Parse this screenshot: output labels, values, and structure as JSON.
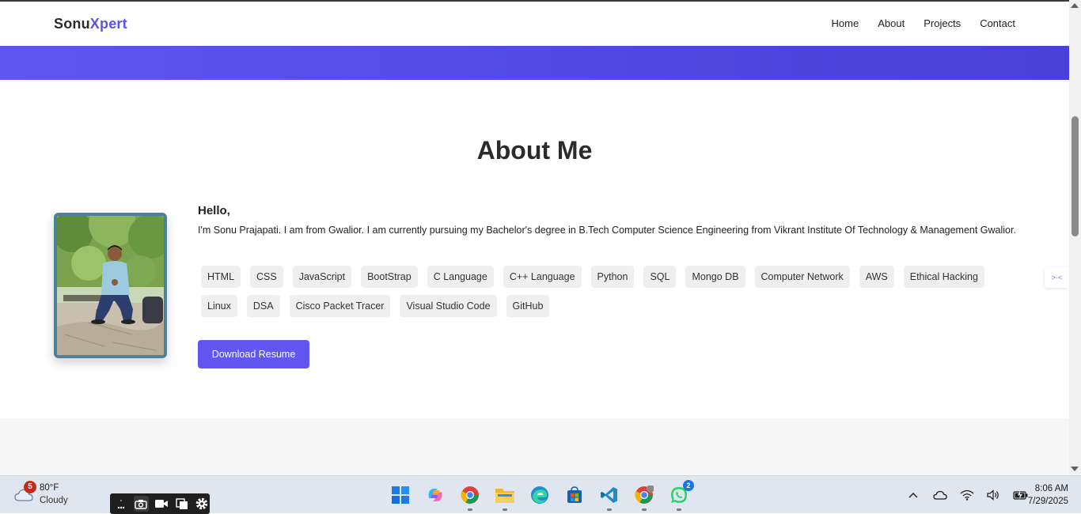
{
  "nav": {
    "brand_part1": "Sonu",
    "brand_part2": "Xpert",
    "links": [
      "Home",
      "About",
      "Projects",
      "Contact"
    ]
  },
  "about": {
    "title": "About Me",
    "greeting": "Hello,",
    "intro": "I'm Sonu Prajapati. I am from Gwalior. I am currently pursuing my Bachelor's degree in B.Tech Computer Science Engineering from Vikrant Institute Of Technology & Management Gwalior.",
    "skills": [
      "HTML",
      "CSS",
      "JavaScript",
      "BootStrap",
      "C Language",
      "C++ Language",
      "Python",
      "SQL",
      "Mongo DB",
      "Computer Network",
      "AWS",
      "Ethical Hacking",
      "Linux",
      "DSA",
      "Cisco Packet Tracer",
      "Visual Studio Code",
      "GitHub"
    ],
    "download_label": "Download Resume"
  },
  "colors": {
    "accent": "#5b53e8",
    "hero_band": "#5147e0",
    "photo_border": "#4e8099"
  },
  "taskbar": {
    "weather_badge": "5",
    "temperature": "80°F",
    "condition": "Cloudy",
    "whatsapp_badge": "2",
    "time": "8:06 AM",
    "date": "7/29/2025",
    "apps": [
      "windows-start-icon",
      "copilot-icon",
      "chrome-icon",
      "file-explorer-icon",
      "edge-icon",
      "microsoft-store-icon",
      "vscode-icon",
      "chrome-profile-icon",
      "whatsapp-icon"
    ]
  }
}
